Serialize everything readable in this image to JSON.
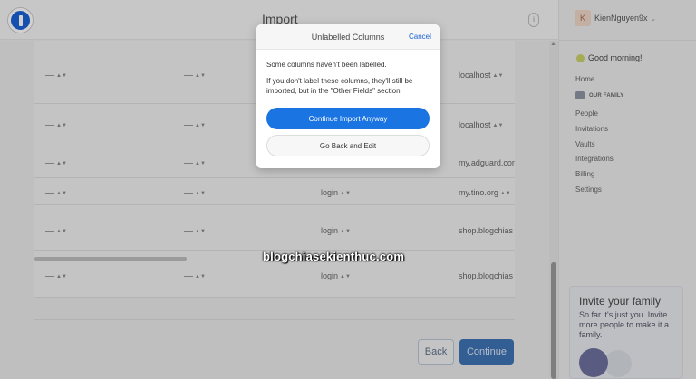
{
  "header": {
    "title": "Import",
    "help_icon": "info-icon"
  },
  "table": {
    "rows": [
      {
        "field": "",
        "value": "localhost"
      },
      {
        "field": "",
        "value": "localhost"
      },
      {
        "field": "",
        "value": "my.adguard.cor"
      },
      {
        "field": "login",
        "value": "my.tino.org"
      },
      {
        "field": "login",
        "value": "shop.blogchias"
      },
      {
        "field": "login",
        "value": "shop.blogchias"
      }
    ]
  },
  "footer": {
    "back_label": "Back",
    "continue_label": "Continue"
  },
  "sidebar": {
    "avatar_initial": "K",
    "username": "KienNguyen9x",
    "greeting": "Good morning!",
    "home": "Home",
    "family_label": "OUR FAMILY",
    "items": [
      "People",
      "Invitations",
      "Vaults",
      "Integrations",
      "Billing",
      "Settings"
    ]
  },
  "invite": {
    "title": "Invite your family",
    "text": "So far it's just you. Invite more people to make it a family."
  },
  "modal": {
    "title": "Unlabelled Columns",
    "cancel_label": "Cancel",
    "text1": "Some columns haven't been labelled.",
    "text2": "If you don't label these columns, they'll still be imported, but in the \"Other Fields\" section.",
    "primary_label": "Continue Import Anyway",
    "secondary_label": "Go Back and Edit"
  },
  "watermark": "blogchiasekienthuc.com",
  "colors": {
    "accent": "#1a74e2",
    "overlay": "rgba(0,0,0,0.18)",
    "logo": "#1a62d6"
  }
}
